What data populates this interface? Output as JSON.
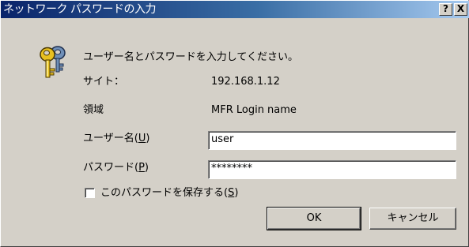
{
  "window": {
    "title": "ネットワーク パスワードの入力",
    "help_button": "?",
    "close_button": "X"
  },
  "dialog": {
    "message": "ユーザー名とパスワードを入力してください。",
    "site_label": "サイト：",
    "site_value": "192.168.1.12",
    "realm_label": "領域",
    "realm_value": "MFR Login name",
    "username_label": "ユーザー名(",
    "username_mnemonic": "U",
    "username_label_end": ")",
    "username_value": "user",
    "password_label": "パスワード(",
    "password_mnemonic": "P",
    "password_label_end": ")",
    "password_value": "********",
    "save_label": "このパスワードを保存する(",
    "save_mnemonic": "S",
    "save_label_end": ")",
    "save_checked": false
  },
  "buttons": {
    "ok_label": "OK",
    "cancel_label": "キャンセル"
  },
  "icon": "keys-icon"
}
